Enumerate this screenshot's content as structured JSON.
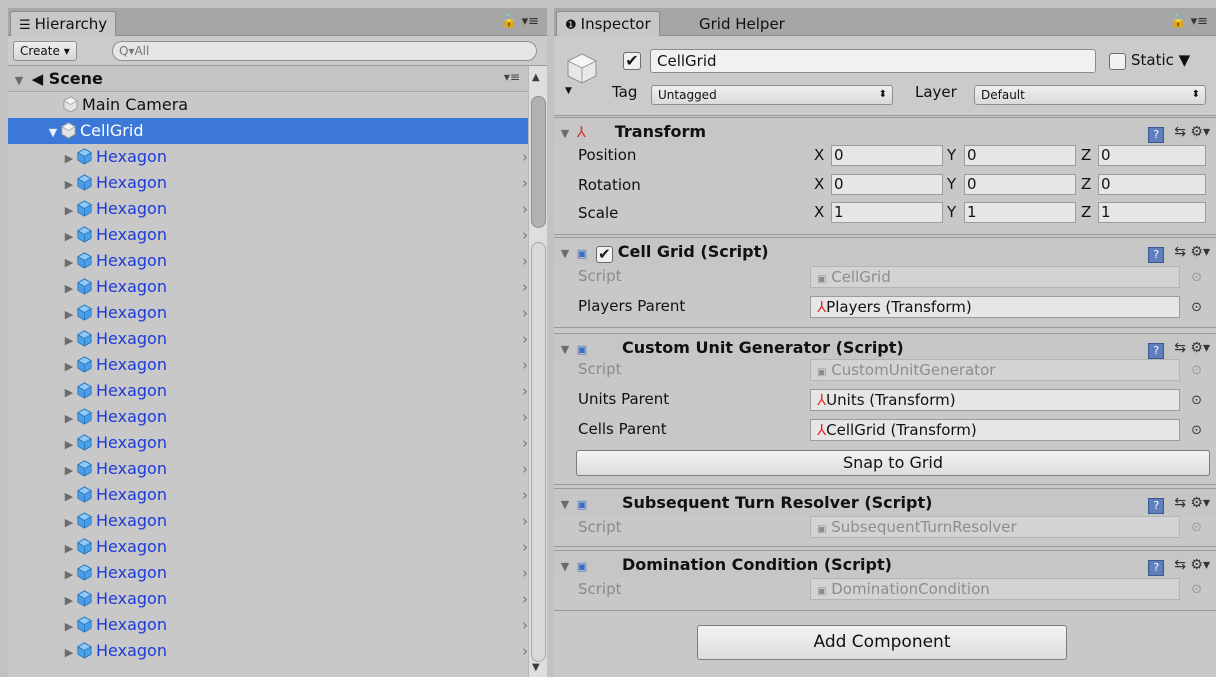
{
  "hierarchy": {
    "tab_label": "Hierarchy",
    "menu_glyph": "🔒 ▾≡",
    "create_label": "Create ▾",
    "search_placeholder": "Q▾All",
    "scene_label": "Scene",
    "scene_menu": "▾≡",
    "items": [
      {
        "label": "Main Camera"
      },
      {
        "label": "CellGrid"
      },
      {
        "label": "Hexagon"
      },
      {
        "label": "Hexagon"
      },
      {
        "label": "Hexagon"
      },
      {
        "label": "Hexagon"
      },
      {
        "label": "Hexagon"
      },
      {
        "label": "Hexagon"
      },
      {
        "label": "Hexagon"
      },
      {
        "label": "Hexagon"
      },
      {
        "label": "Hexagon"
      },
      {
        "label": "Hexagon"
      },
      {
        "label": "Hexagon"
      },
      {
        "label": "Hexagon"
      },
      {
        "label": "Hexagon"
      },
      {
        "label": "Hexagon"
      },
      {
        "label": "Hexagon"
      },
      {
        "label": "Hexagon"
      },
      {
        "label": "Hexagon"
      },
      {
        "label": "Hexagon"
      },
      {
        "label": "Hexagon"
      },
      {
        "label": "Hexagon"
      }
    ],
    "chevron": "›"
  },
  "inspector": {
    "tab_label": "Inspector",
    "tab2_label": "Grid Helper",
    "menu_glyph": "🔒 ▾≡",
    "object_name": "CellGrid",
    "static_label": "Static ▼",
    "tag_label": "Tag",
    "tag_value": "Untagged",
    "layer_label": "Layer",
    "layer_value": "Default",
    "transform": {
      "title": "Transform",
      "position_label": "Position",
      "rotation_label": "Rotation",
      "scale_label": "Scale",
      "x": "X",
      "y": "Y",
      "z": "Z",
      "position": [
        "0",
        "0",
        "0"
      ],
      "rotation": [
        "0",
        "0",
        "0"
      ],
      "scale": [
        "1",
        "1",
        "1"
      ]
    },
    "cell_grid": {
      "title": "Cell Grid (Script)",
      "script_label": "Script",
      "script_value": "CellGrid",
      "players_label": "Players Parent",
      "players_value": "Players (Transform)"
    },
    "unit_generator": {
      "title": "Custom Unit Generator (Script)",
      "script_label": "Script",
      "script_value": "CustomUnitGenerator",
      "units_label": "Units Parent",
      "units_value": "Units (Transform)",
      "cells_label": "Cells Parent",
      "cells_value": "CellGrid (Transform)",
      "snap_button": "Snap to Grid"
    },
    "turn_resolver": {
      "title": "Subsequent Turn Resolver (Script)",
      "script_label": "Script",
      "script_value": "SubsequentTurnResolver"
    },
    "domination": {
      "title": "Domination Condition (Script)",
      "script_label": "Script",
      "script_value": "DominationCondition"
    },
    "add_component": "Add Component"
  },
  "colors": {
    "selection": "#3c78d8",
    "hex_text": "#1e3bd8",
    "panel": "#c8c8c8"
  }
}
